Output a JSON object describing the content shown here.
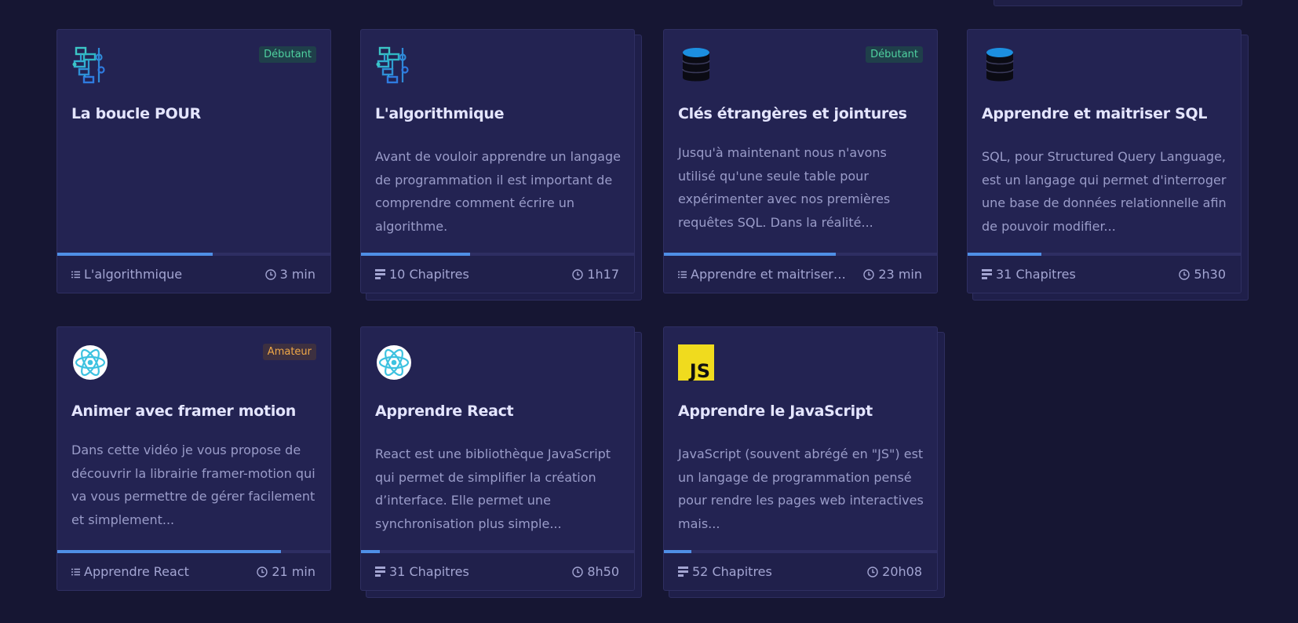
{
  "cards": [
    {
      "title": "La boucle POUR",
      "badge": "Débutant",
      "description": "",
      "footer_left": "L'algorithmique",
      "footer_right": "3 min",
      "progress": 0.57,
      "icon": "flowchart-icon",
      "footer_icon": "list-icon"
    },
    {
      "title": "L'algorithmique",
      "badge": "",
      "description": "Avant de vouloir apprendre un langage de programmation il est important de comprendre comment écrire un algorithme.",
      "footer_left": "10 Chapitres",
      "footer_right": "1h17",
      "progress": 0.4,
      "icon": "flowchart-icon",
      "footer_icon": "chapters-icon"
    },
    {
      "title": "Clés étrangères et jointures",
      "badge": "Débutant",
      "description": "Jusqu'à maintenant nous n'avons utilisé qu'une seule table pour expérimenter avec nos premières requêtes SQL. Dans la réalité...",
      "footer_left": "Apprendre et maitriser S...",
      "footer_right": "23 min",
      "progress": 0.63,
      "icon": "database-icon",
      "footer_icon": "list-icon"
    },
    {
      "title": "Apprendre et maitriser SQL",
      "badge": "",
      "description": "SQL, pour Structured Query Language, est un langage qui permet d'interroger une base de données relationnelle afin de pouvoir modifier...",
      "footer_left": "31 Chapitres",
      "footer_right": "5h30",
      "progress": 0.27,
      "icon": "database-icon",
      "footer_icon": "chapters-icon"
    },
    {
      "title": "Animer avec framer motion",
      "badge": "Amateur",
      "description": "Dans cette vidéo je vous propose de découvrir la librairie framer-motion qui va vous permettre de gérer facilement et simplement...",
      "footer_left": "Apprendre React",
      "footer_right": "21 min",
      "progress": 0.82,
      "icon": "react-icon",
      "footer_icon": "list-icon"
    },
    {
      "title": "Apprendre React",
      "badge": "",
      "description": "React est une bibliothèque JavaScript qui permet de simplifier la création d’interface. Elle permet une synchronisation plus simple...",
      "footer_left": "31 Chapitres",
      "footer_right": "8h50",
      "progress": 0.07,
      "icon": "react-icon",
      "footer_icon": "chapters-icon"
    },
    {
      "title": "Apprendre le JavaScript",
      "badge": "",
      "description": "JavaScript (souvent abrégé en \"JS\") est un langage de programmation pensé pour rendre les pages web interactives mais...",
      "footer_left": "52 Chapitres",
      "footer_right": "20h08",
      "progress": 0.1,
      "icon": "javascript-icon",
      "icon_text": "JS",
      "footer_icon": "chapters-icon"
    }
  ]
}
